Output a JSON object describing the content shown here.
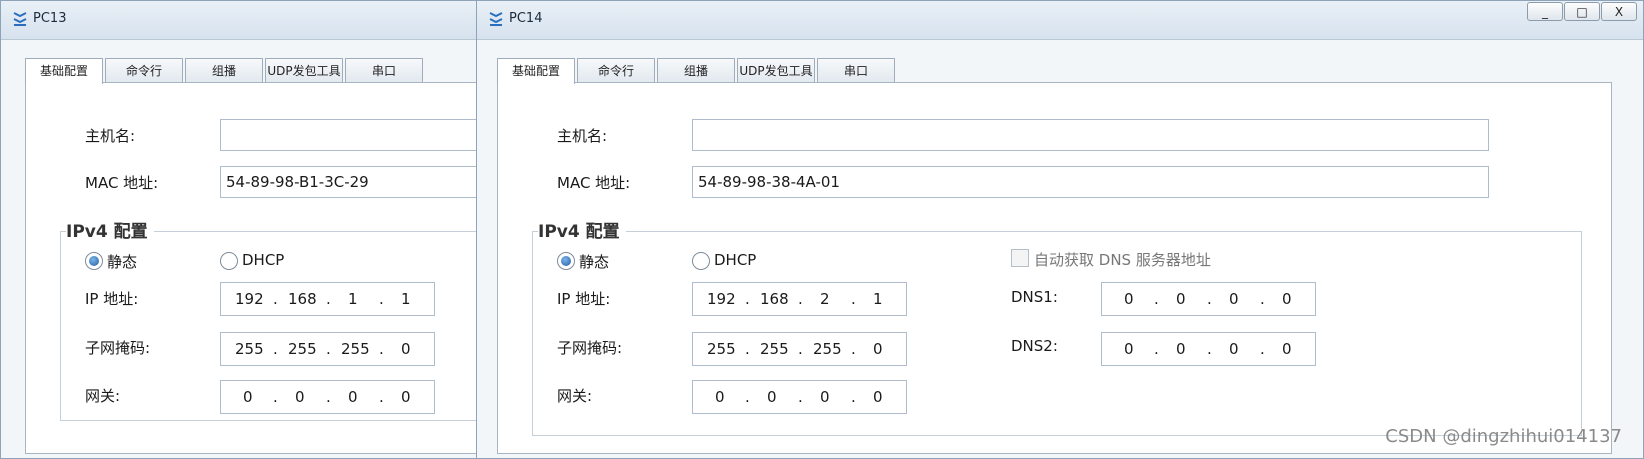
{
  "watermark": "CSDN @dingzhihui014137",
  "tabs": [
    "基础配置",
    "命令行",
    "组播",
    "UDP发包工具",
    "串口"
  ],
  "labels": {
    "hostname": "主机名:",
    "mac": "MAC 地址:",
    "ipv4_section": "IPv4 配置",
    "static": "静态",
    "dhcp": "DHCP",
    "ip": "IP 地址:",
    "mask": "子网掩码:",
    "gateway": "网关:",
    "auto_dns": "自动获取 DNS 服务器地址",
    "dns1": "DNS1:",
    "dns2": "DNS2:"
  },
  "window_controls": [
    "_",
    "□",
    "X"
  ],
  "windows": [
    {
      "title": "PC13",
      "mac": "54-89-98-B1-3C-29",
      "ip": [
        "192",
        "168",
        "1",
        "1"
      ],
      "mask": [
        "255",
        "255",
        "255",
        "0"
      ],
      "gateway": [
        "0",
        "0",
        "0",
        "0"
      ],
      "mode": "static"
    },
    {
      "title": "PC14",
      "mac": "54-89-98-38-4A-01",
      "ip": [
        "192",
        "168",
        "2",
        "1"
      ],
      "mask": [
        "255",
        "255",
        "255",
        "0"
      ],
      "gateway": [
        "0",
        "0",
        "0",
        "0"
      ],
      "dns1": [
        "0",
        "0",
        "0",
        "0"
      ],
      "dns2": [
        "0",
        "0",
        "0",
        "0"
      ],
      "mode": "static"
    }
  ],
  "colors": {
    "accent": "#1e5fa8",
    "panel_border": "#a8b6c4",
    "titlebar": "#d6e2ee"
  }
}
